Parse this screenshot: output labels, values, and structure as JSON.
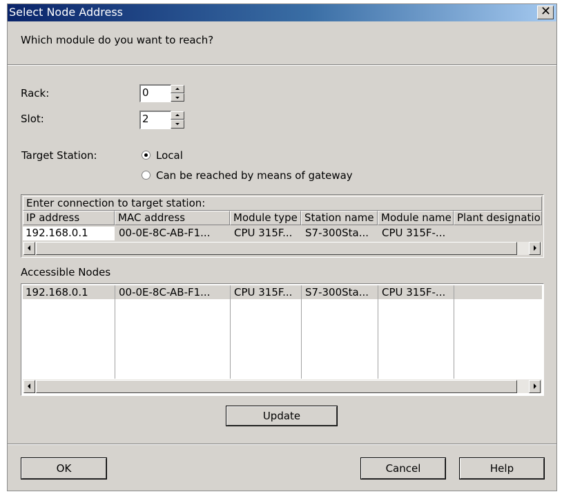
{
  "window": {
    "title": "Select Node Address",
    "question": "Which module do you want to reach?"
  },
  "fields": {
    "rack_label": "Rack:",
    "rack_value": "0",
    "slot_label": "Slot:",
    "slot_value": "2"
  },
  "target": {
    "label": "Target Station:",
    "options": [
      {
        "label": "Local",
        "selected": true
      },
      {
        "label": "Can be reached by means of gateway",
        "selected": false
      }
    ]
  },
  "connection": {
    "caption": "Enter connection to target station:",
    "columns": [
      "IP address",
      "MAC address",
      "Module type",
      "Station name",
      "Module name",
      "Plant designation"
    ],
    "row": [
      "192.168.0.1",
      "00-0E-8C-AB-F1...",
      "CPU 315F...",
      "S7-300Sta...",
      "CPU 315F-...",
      ""
    ]
  },
  "accessible": {
    "label": "Accessible Nodes",
    "rows": [
      [
        "192.168.0.1",
        "00-0E-8C-AB-F1...",
        "CPU 315F...",
        "S7-300Sta...",
        "CPU 315F-...",
        ""
      ]
    ]
  },
  "buttons": {
    "update": "Update",
    "ok": "OK",
    "cancel": "Cancel",
    "help": "Help"
  }
}
